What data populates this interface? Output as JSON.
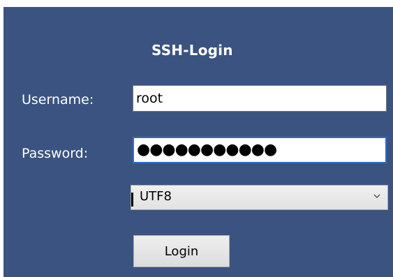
{
  "dialog": {
    "title": "SSH-Login",
    "username_label": "Username:",
    "password_label": "Password:",
    "username_value": "root",
    "password_mask": "●●●●●●●●●●●",
    "encoding_selected": "UTF8",
    "login_label": "Login"
  },
  "colors": {
    "panel_background": "#3b5380",
    "focus_border": "#2e6fd1"
  },
  "icons": {
    "dropdown": "chevron-down-icon"
  }
}
